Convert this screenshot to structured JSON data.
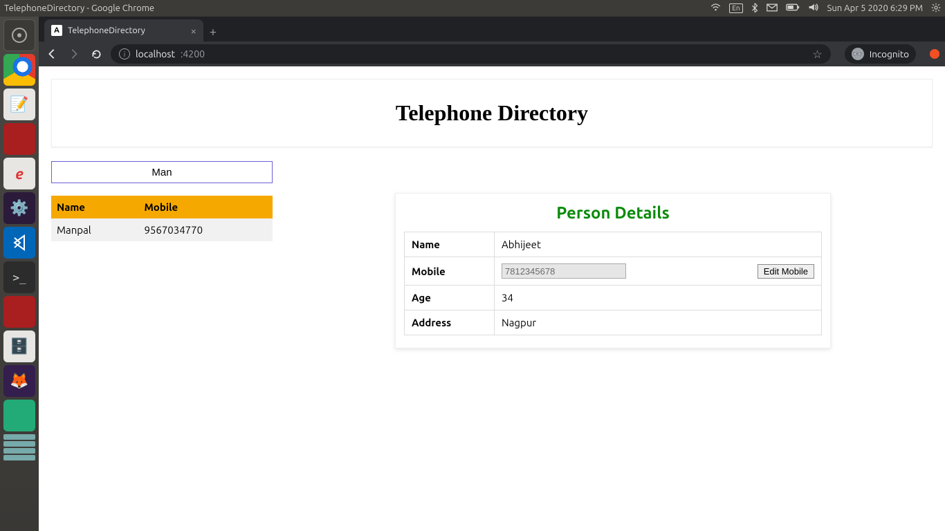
{
  "os": {
    "window_title": "TelephoneDirectory - Google Chrome",
    "lang_indicator": "En",
    "datetime": "Sun Apr  5 2020   6:29 PM"
  },
  "browser": {
    "tab_title": "TelephoneDirectory",
    "url_host": "localhost",
    "url_port": ":4200",
    "incognito_label": "Incognito"
  },
  "page": {
    "title": "Telephone Directory",
    "search_value": "Man",
    "results": {
      "headers": {
        "name": "Name",
        "mobile": "Mobile"
      },
      "rows": [
        {
          "name": "Manpal",
          "mobile": "9567034770"
        }
      ]
    },
    "details": {
      "heading": "Person Details",
      "labels": {
        "name": "Name",
        "mobile": "Mobile",
        "age": "Age",
        "address": "Address"
      },
      "name": "Abhijeet",
      "mobile": "7812345678",
      "edit_mobile_label": "Edit Mobile",
      "age": "34",
      "address": "Nagpur"
    }
  }
}
